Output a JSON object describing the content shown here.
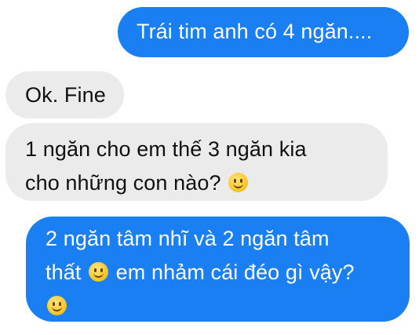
{
  "messages": [
    {
      "id": "m1",
      "type": "sent",
      "lines": [
        "Trái tim anh có 4 ngăn...."
      ]
    },
    {
      "id": "m2",
      "type": "received",
      "lines": [
        "Ok. Fine"
      ]
    },
    {
      "id": "m3",
      "type": "received",
      "lines": [
        "1 ngăn cho em thế 3 ngăn kia",
        "cho những con nào?"
      ],
      "emoji": "smiley-emoji"
    },
    {
      "id": "m4",
      "type": "sent",
      "lines": [
        "2 ngăn tâm nhĩ và 2 ngăn tâm",
        "thất",
        "em nhảm cái đéo gì vậy?"
      ],
      "emoji": "smiley-emoji"
    }
  ],
  "colors": {
    "sent_bubble": "#1a7ff2",
    "received_bubble": "#ebebec",
    "sent_text": "#ffffff",
    "received_text": "#111111"
  }
}
